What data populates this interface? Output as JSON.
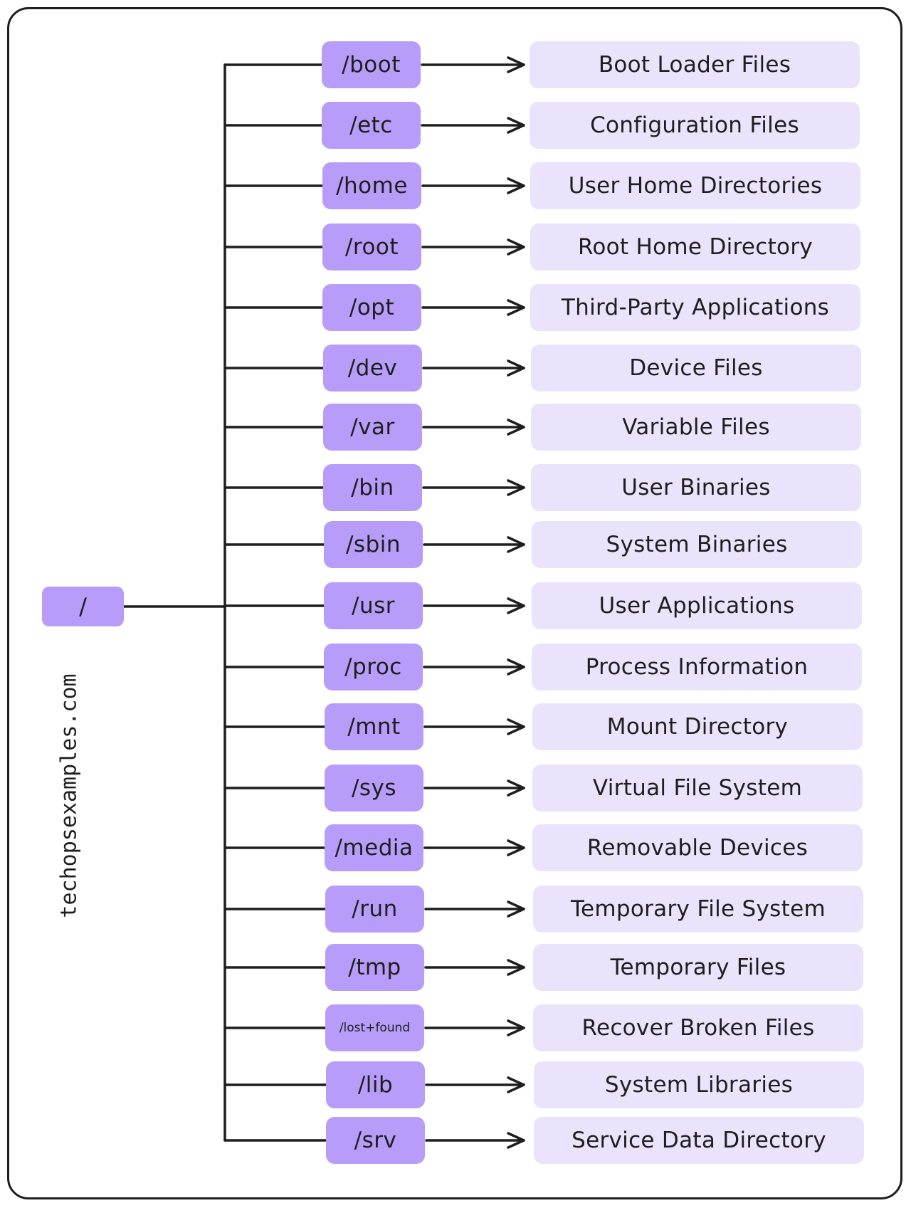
{
  "diagram": {
    "root": {
      "label": "/"
    },
    "watermark": "techopsexamples.com",
    "colors": {
      "dir_fill": "#b79cf9",
      "desc_fill": "#ebe3fb",
      "stroke": "#1e1e1e"
    },
    "entries": [
      {
        "dir": "/boot",
        "description": "Boot Loader Files"
      },
      {
        "dir": "/etc",
        "description": "Configuration Files"
      },
      {
        "dir": "/home",
        "description": "User Home Directories"
      },
      {
        "dir": "/root",
        "description": "Root Home Directory"
      },
      {
        "dir": "/opt",
        "description": "Third-Party Applications"
      },
      {
        "dir": "/dev",
        "description": "Device Files"
      },
      {
        "dir": "/var",
        "description": "Variable Files"
      },
      {
        "dir": "/bin",
        "description": "User Binaries"
      },
      {
        "dir": "/sbin",
        "description": "System Binaries"
      },
      {
        "dir": "/usr",
        "description": "User Applications"
      },
      {
        "dir": "/proc",
        "description": "Process Information"
      },
      {
        "dir": "/mnt",
        "description": "Mount Directory"
      },
      {
        "dir": "/sys",
        "description": "Virtual File System"
      },
      {
        "dir": "/media",
        "description": "Removable Devices"
      },
      {
        "dir": "/run",
        "description": "Temporary File System"
      },
      {
        "dir": "/tmp",
        "description": "Temporary Files"
      },
      {
        "dir": "/lost+found",
        "description": "Recover Broken Files"
      },
      {
        "dir": "/lib",
        "description": "System Libraries"
      },
      {
        "dir": "/srv",
        "description": "Service Data Directory"
      }
    ]
  }
}
